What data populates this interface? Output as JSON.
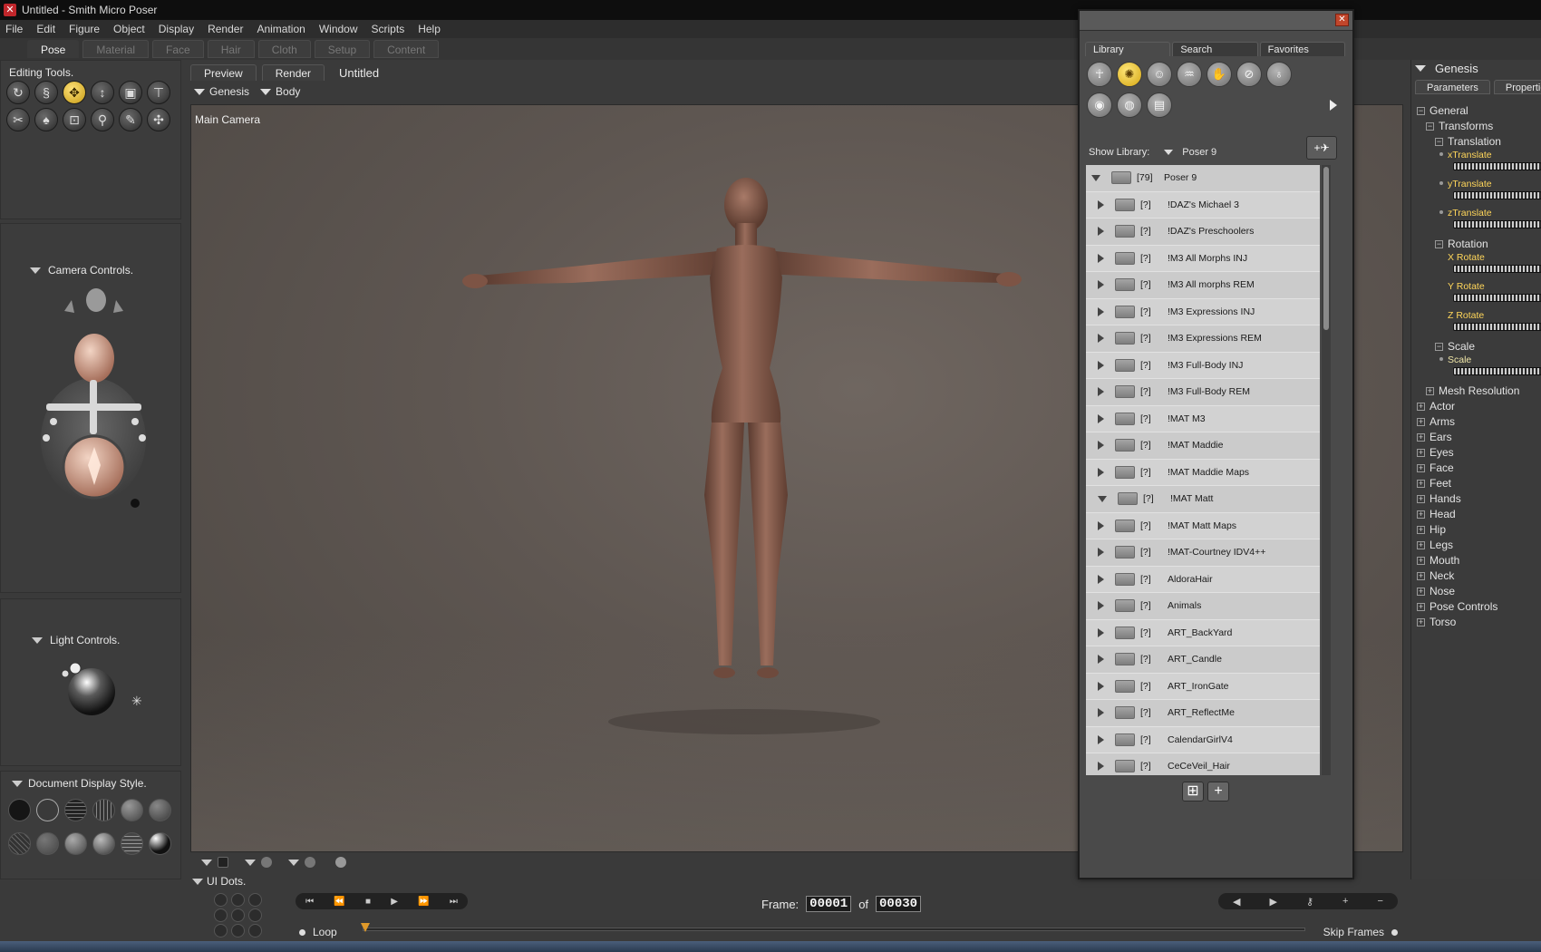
{
  "window": {
    "title": "Untitled - Smith Micro Poser"
  },
  "menu": [
    "File",
    "Edit",
    "Figure",
    "Object",
    "Display",
    "Render",
    "Animation",
    "Window",
    "Scripts",
    "Help"
  ],
  "rooms": [
    "Pose",
    "Material",
    "Face",
    "Hair",
    "Cloth",
    "Setup",
    "Content"
  ],
  "active_room": "Pose",
  "panels": {
    "editing_tools": "Editing Tools.",
    "camera_controls": "Camera Controls.",
    "light_controls": "Light Controls.",
    "document_display_style": "Document Display Style.",
    "ui_dots": "UI Dots."
  },
  "document": {
    "tabs": [
      "Preview",
      "Render"
    ],
    "title": "Untitled",
    "figure_select": "Genesis",
    "part_select": "Body",
    "camera_label": "Main Camera"
  },
  "timeline": {
    "frame_label": "Frame:",
    "current_frame": "00001",
    "of_label": "of",
    "total_frames": "00030",
    "loop_label": "Loop",
    "skip_frames_label": "Skip Frames"
  },
  "library": {
    "tabs": [
      "Library",
      "Search",
      "Favorites"
    ],
    "show_library_label": "Show Library:",
    "show_library_value": "Poser 9",
    "root": {
      "count": "[79]",
      "name": "Poser 9"
    },
    "items": [
      {
        "count": "[?]",
        "name": "!DAZ's Michael 3"
      },
      {
        "count": "[?]",
        "name": "!DAZ's Preschoolers"
      },
      {
        "count": "[?]",
        "name": "!M3 All Morphs INJ"
      },
      {
        "count": "[?]",
        "name": "!M3 All morphs REM"
      },
      {
        "count": "[?]",
        "name": "!M3 Expressions INJ"
      },
      {
        "count": "[?]",
        "name": "!M3 Expressions REM"
      },
      {
        "count": "[?]",
        "name": "!M3 Full-Body INJ"
      },
      {
        "count": "[?]",
        "name": "!M3 Full-Body REM"
      },
      {
        "count": "[?]",
        "name": "!MAT M3"
      },
      {
        "count": "[?]",
        "name": "!MAT Maddie"
      },
      {
        "count": "[?]",
        "name": "!MAT Maddie Maps"
      },
      {
        "count": "[?]",
        "name": "!MAT Matt",
        "open": true
      },
      {
        "count": "[?]",
        "name": "!MAT Matt Maps"
      },
      {
        "count": "[?]",
        "name": "!MAT-Courtney IDV4++"
      },
      {
        "count": "[?]",
        "name": "AldoraHair"
      },
      {
        "count": "[?]",
        "name": "Animals"
      },
      {
        "count": "[?]",
        "name": "ART_BackYard"
      },
      {
        "count": "[?]",
        "name": "ART_Candle"
      },
      {
        "count": "[?]",
        "name": "ART_IronGate"
      },
      {
        "count": "[?]",
        "name": "ART_ReflectMe"
      },
      {
        "count": "[?]",
        "name": "CalendarGirlV4"
      },
      {
        "count": "[?]",
        "name": "CeCeVeil_Hair"
      }
    ]
  },
  "parameters": {
    "actor": "Genesis",
    "tabs": [
      "Parameters",
      "Properties"
    ],
    "general": "General",
    "transforms": "Transforms",
    "translation": "Translation",
    "xtranslate": "xTranslate",
    "ytranslate": "yTranslate",
    "ztranslate": "zTranslate",
    "rotation": "Rotation",
    "xrotate": "X Rotate",
    "yrotate": "Y Rotate",
    "zrotate": "Z Rotate",
    "scale_group": "Scale",
    "scale": "Scale",
    "mesh_resolution": "Mesh Resolution",
    "groups": [
      "Actor",
      "Arms",
      "Ears",
      "Eyes",
      "Face",
      "Feet",
      "Hands",
      "Head",
      "Hip",
      "Legs",
      "Mouth",
      "Neck",
      "Nose",
      "Pose Controls",
      "Torso"
    ]
  },
  "colors": {
    "accent": "#e0a81e",
    "viewport": "#5e5651",
    "panel": "#3c3c3c"
  }
}
